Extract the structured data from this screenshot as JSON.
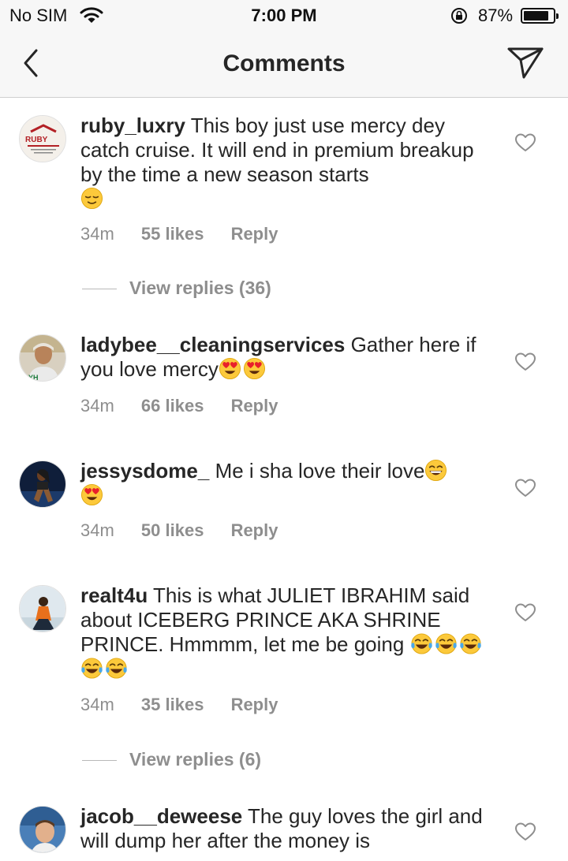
{
  "status_bar": {
    "carrier": "No SIM",
    "time": "7:00 PM",
    "battery_percent_label": "87%",
    "battery_level": 0.87
  },
  "header": {
    "title": "Comments"
  },
  "comments": [
    {
      "username": "ruby_luxry",
      "text": "This boy just use mercy dey catch cruise. It will end in premium breakup by the time a new season starts",
      "emojis": [
        "relieved-face"
      ],
      "time": "34m",
      "likes": "55 likes",
      "reply": "Reply",
      "view_replies": "View replies (36)"
    },
    {
      "username": "ladybee__cleaningservices",
      "text": "Gather here if you love mercy",
      "emojis": [
        "heart-eyes",
        "heart-eyes"
      ],
      "time": "34m",
      "likes": "66 likes",
      "reply": "Reply"
    },
    {
      "username": "jessysdome_",
      "text": "Me i sha love their love",
      "emojis": [
        "grinning-face",
        "heart-eyes"
      ],
      "time": "34m",
      "likes": "50 likes",
      "reply": "Reply"
    },
    {
      "username": "realt4u",
      "text": "This is what JULIET IBRAHIM said about ICEBERG PRINCE AKA SHRINE PRINCE. Hmmmm, let me be going",
      "emojis": [
        "tears-of-joy",
        "tears-of-joy",
        "tears-of-joy",
        "tears-of-joy",
        "tears-of-joy"
      ],
      "time": "34m",
      "likes": "35 likes",
      "reply": "Reply",
      "view_replies": "View replies (6)"
    },
    {
      "username": "jacob__deweese",
      "text": "The guy loves the girl and will dump her after the money is"
    }
  ]
}
